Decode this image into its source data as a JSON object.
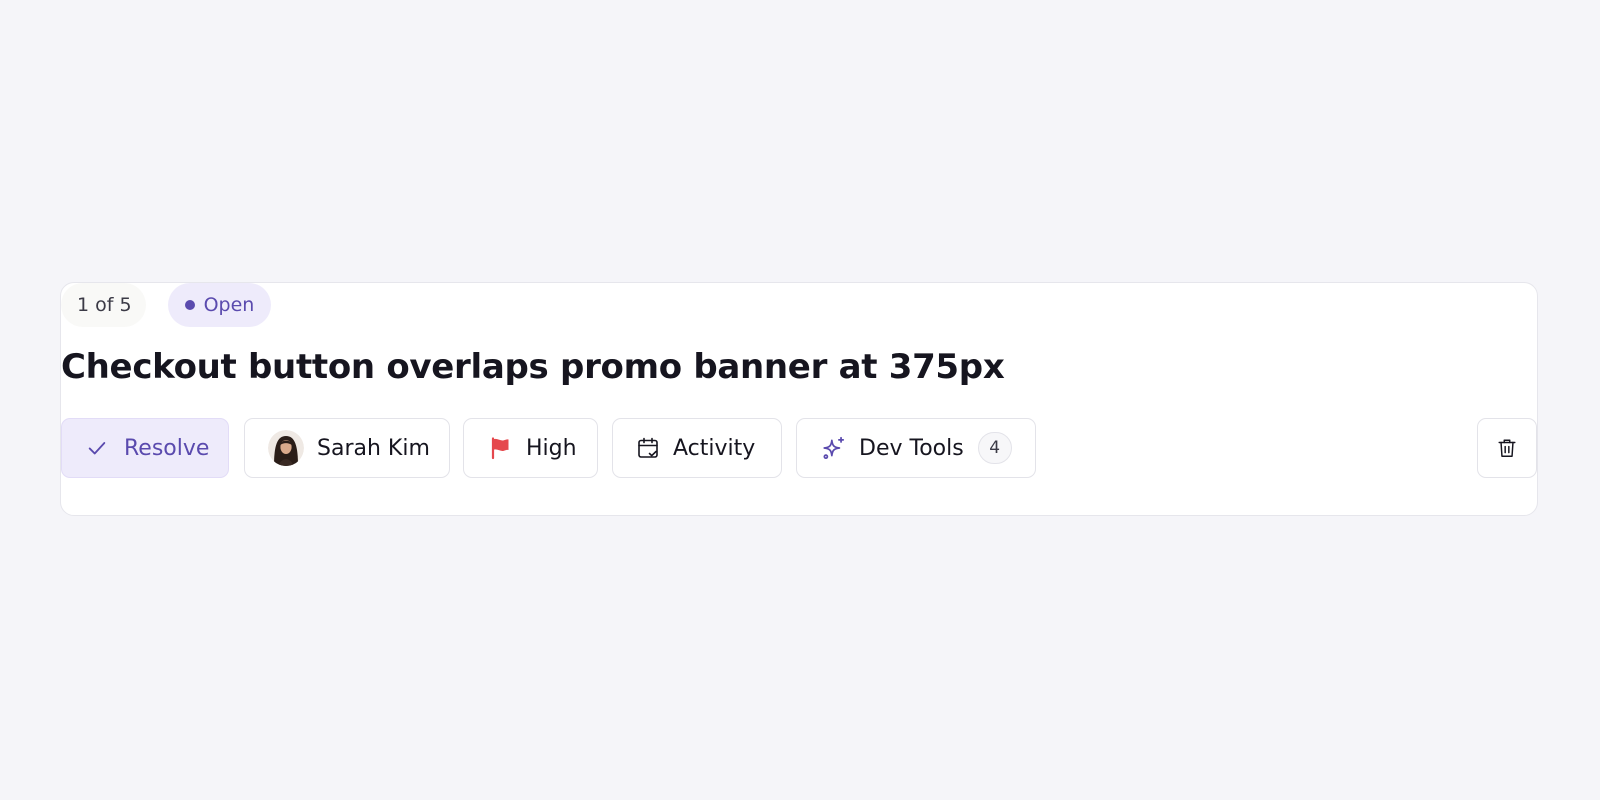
{
  "issue": {
    "counter": "1 of 5",
    "status": "Open",
    "title": "Checkout button overlaps promo banner at 375px"
  },
  "actions": {
    "resolve_label": "Resolve",
    "assignee_name": "Sarah Kim",
    "priority_label": "High",
    "activity_label": "Activity",
    "devtools_label": "Dev Tools",
    "devtools_count": "4"
  },
  "icons": {
    "resolve": "check-icon",
    "assignee": "avatar",
    "priority": "flag-icon",
    "activity": "calendar-check-icon",
    "devtools": "sparkles-icon",
    "delete": "trash-icon"
  },
  "colors": {
    "accent": "#5a4aae",
    "accent_bg": "#eeebfb",
    "priority_flag": "#e5484d",
    "page_bg": "#f5f5f9"
  }
}
